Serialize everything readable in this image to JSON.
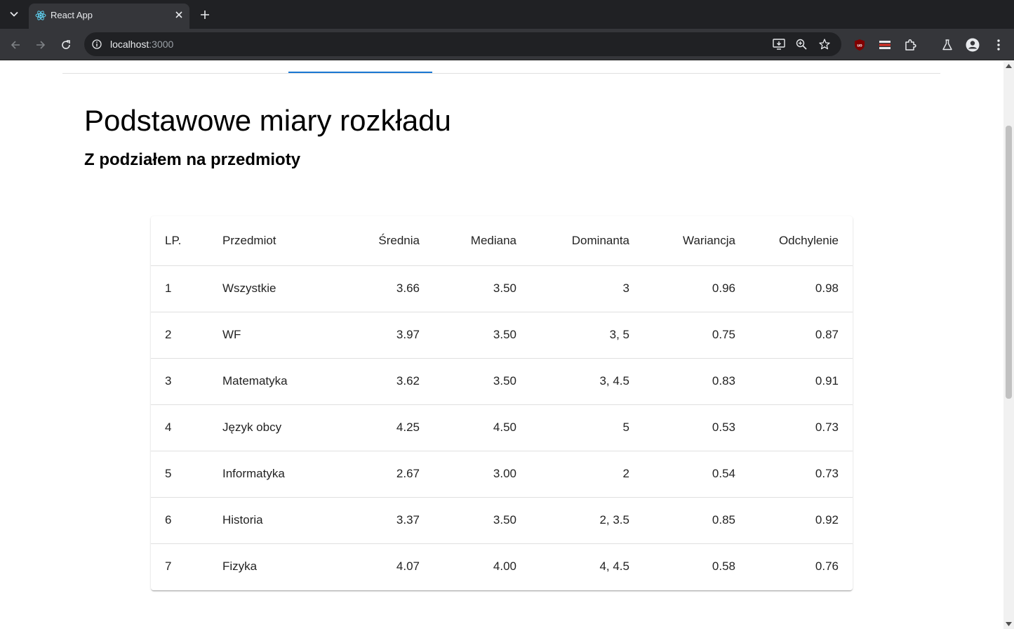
{
  "browser": {
    "tab_title": "React App",
    "url_host": "localhost",
    "url_port": ":3000"
  },
  "page": {
    "title": "Podstawowe miary rozkładu",
    "subtitle": "Z podziałem na przedmioty"
  },
  "table": {
    "headers": [
      "LP.",
      "Przedmiot",
      "Średnia",
      "Mediana",
      "Dominanta",
      "Wariancja",
      "Odchylenie"
    ],
    "rows": [
      [
        "1",
        "Wszystkie",
        "3.66",
        "3.50",
        "3",
        "0.96",
        "0.98"
      ],
      [
        "2",
        "WF",
        "3.97",
        "3.50",
        "3, 5",
        "0.75",
        "0.87"
      ],
      [
        "3",
        "Matematyka",
        "3.62",
        "3.50",
        "3, 4.5",
        "0.83",
        "0.91"
      ],
      [
        "4",
        "Język obcy",
        "4.25",
        "4.50",
        "5",
        "0.53",
        "0.73"
      ],
      [
        "5",
        "Informatyka",
        "2.67",
        "3.00",
        "2",
        "0.54",
        "0.73"
      ],
      [
        "6",
        "Historia",
        "3.37",
        "3.50",
        "2, 3.5",
        "0.85",
        "0.92"
      ],
      [
        "7",
        "Fizyka",
        "4.07",
        "4.00",
        "4, 4.5",
        "0.58",
        "0.76"
      ]
    ]
  },
  "colors": {
    "accent": "#1976d2",
    "chrome_dark": "#202124",
    "chrome_toolbar": "#35363a"
  },
  "icons": [
    "tab-list-icon",
    "react-favicon-icon",
    "close-icon",
    "plus-icon",
    "back-icon",
    "forward-icon",
    "reload-icon",
    "site-info-icon",
    "install-app-icon",
    "zoom-icon",
    "star-icon",
    "ublock-icon",
    "extension-red-icon",
    "puzzle-icon",
    "labs-icon",
    "profile-icon",
    "menu-icon"
  ]
}
